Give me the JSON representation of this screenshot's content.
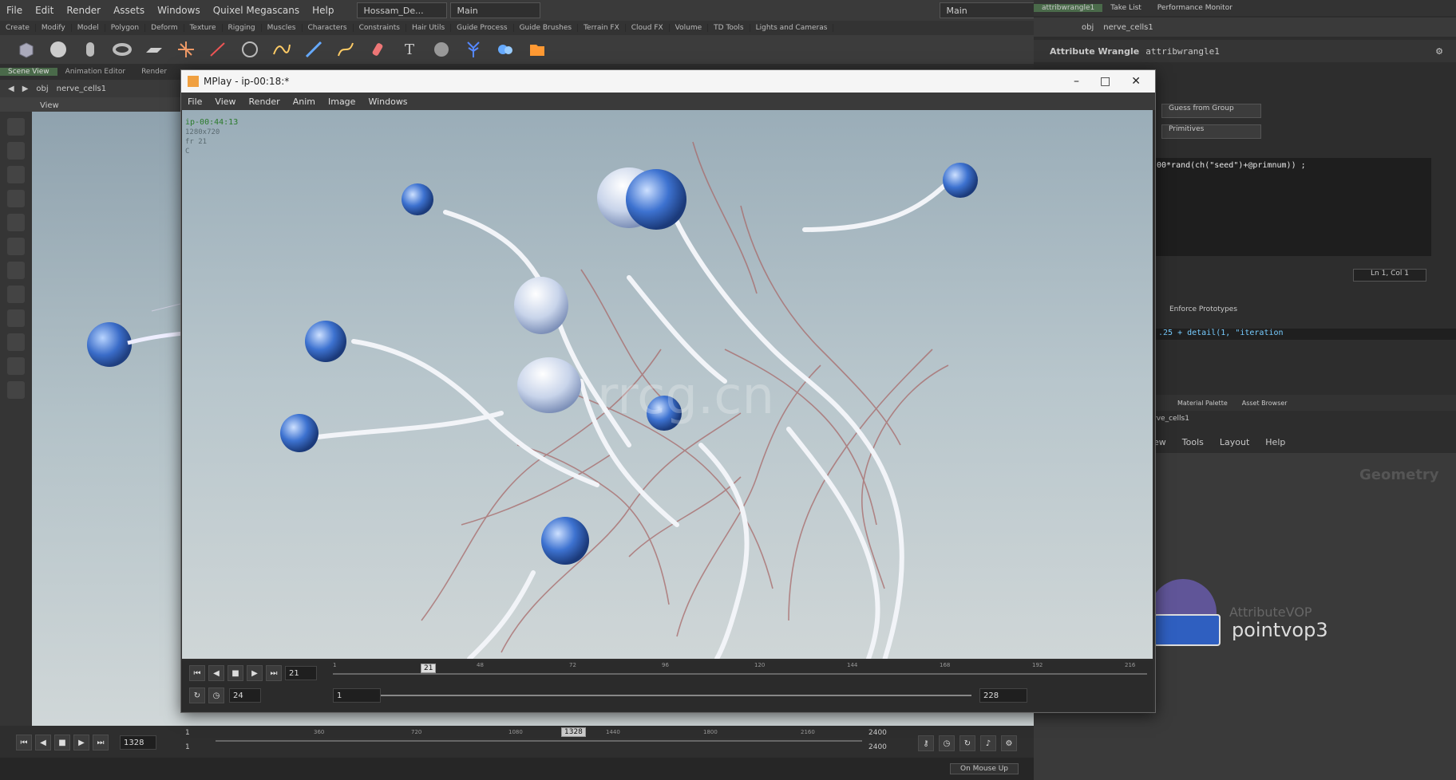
{
  "main_menu": [
    "File",
    "Edit",
    "Render",
    "Assets",
    "Windows",
    "Quixel Megascans",
    "Help"
  ],
  "desktop_dropdown": "Hossam_De...",
  "main_dropdown": "Main",
  "right_main_dropdown": "Main",
  "shelf_tabs": [
    "Create",
    "Modify",
    "Model",
    "Polygon",
    "Deform",
    "Texture",
    "Rigging",
    "Muscles",
    "Characters",
    "Constraints",
    "Hair Utils",
    "Guide Process",
    "Guide Brushes",
    "Terrain FX",
    "Cloud FX",
    "Volume",
    "TD Tools",
    "Lights and Cameras"
  ],
  "viewer_tabs": [
    "Scene View",
    "Animation Editor",
    "Render"
  ],
  "path": {
    "root": "obj",
    "node": "nerve_cells1"
  },
  "view_label": "View",
  "timeline": {
    "frame": "1328",
    "start": "1",
    "start2": "1",
    "end": "2400",
    "end2": "2400",
    "ticks": [
      "360",
      "720",
      "1080",
      "1440",
      "1800",
      "2160"
    ],
    "current_marker": "1328",
    "on_mouse_up": "On Mouse Up"
  },
  "right_panel": {
    "top_tabs": [
      "attribwrangle1",
      "Take List",
      "Performance Monitor"
    ],
    "path": {
      "root": "obj",
      "node": "nerve_cells1"
    },
    "node_type": "Attribute Wrangle",
    "node_name": "attribwrangle1",
    "group_type": "Guess from Group",
    "run_over": "Primitives",
    "code": "00*rand(ch(\"seed\")+@primnum)) ;",
    "status": "Ln 1, Col 1",
    "enforce_prototypes": "Enforce Prototypes",
    "expression": ".25 + detail(1, \"iteration",
    "network_tabs": [
      "Material Palette",
      "Asset Browser"
    ],
    "network_path": "rve_cells1",
    "network_menu": [
      "ew",
      "Tools",
      "Layout",
      "Help"
    ],
    "geometry_label": "Geometry",
    "node_label": "pointvop3",
    "node_ghost_label": "AttributeVOP"
  },
  "mplay": {
    "title": "MPlay - ip-00:18:*",
    "menu": [
      "File",
      "View",
      "Render",
      "Anim",
      "Image",
      "Windows"
    ],
    "overlay": [
      "ip-00:44:13",
      "1280x720",
      "fr 21",
      "C"
    ],
    "watermark": "rrcg.cn",
    "frame": "21",
    "fps": "24",
    "range_start": "1",
    "range_end": "228",
    "ticks": [
      "1",
      "48",
      "72",
      "96",
      "120",
      "144",
      "168",
      "192",
      "216"
    ]
  },
  "icons": [
    "box-icon",
    "sphere-icon",
    "tube-icon",
    "torus-icon",
    "grid-icon",
    "null-icon",
    "line-icon",
    "circle-icon",
    "curve-icon",
    "draw-curve-icon",
    "path-icon",
    "spray-paint-icon",
    "font-icon",
    "platonic-icon",
    "l-system-icon",
    "metaball-icon",
    "file-icon"
  ]
}
